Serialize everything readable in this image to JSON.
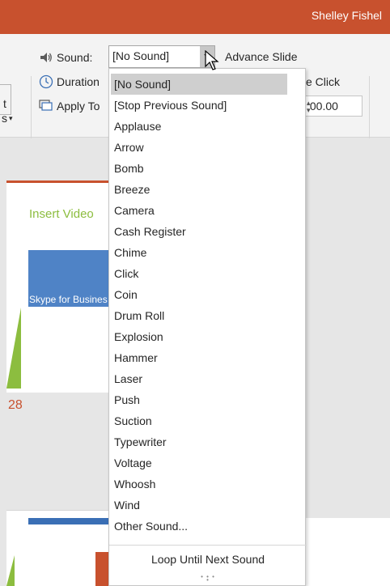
{
  "titlebar": {
    "user_name": "Shelley Fishel"
  },
  "ribbon": {
    "sound_label": "Sound:",
    "sound_value": "[No Sound]",
    "advance_slide_label": "Advance Slide",
    "duration_label": "Duration",
    "on_click_label": "e Click",
    "apply_to_all_label": "Apply To",
    "after_time_value": ":00.00",
    "left_partial_1": "t",
    "left_partial_2": "s"
  },
  "dropdown": {
    "items": [
      "[No Sound]",
      "[Stop Previous Sound]",
      "Applause",
      "Arrow",
      "Bomb",
      "Breeze",
      "Camera",
      "Cash Register",
      "Chime",
      "Click",
      "Coin",
      "Drum Roll",
      "Explosion",
      "Hammer",
      "Laser",
      "Push",
      "Suction",
      "Typewriter",
      "Voltage",
      "Whoosh",
      "Wind",
      "Other Sound..."
    ],
    "selected": "[No Sound]",
    "loop_label": "Loop Until Next Sound"
  },
  "thumbnails": {
    "slide_title": "Insert Video",
    "image_caption": "Skype for Busines",
    "slide_number": "28"
  },
  "colors": {
    "accent": "#c8512e",
    "green": "#8cbd3f",
    "blue": "#4f83c6"
  }
}
